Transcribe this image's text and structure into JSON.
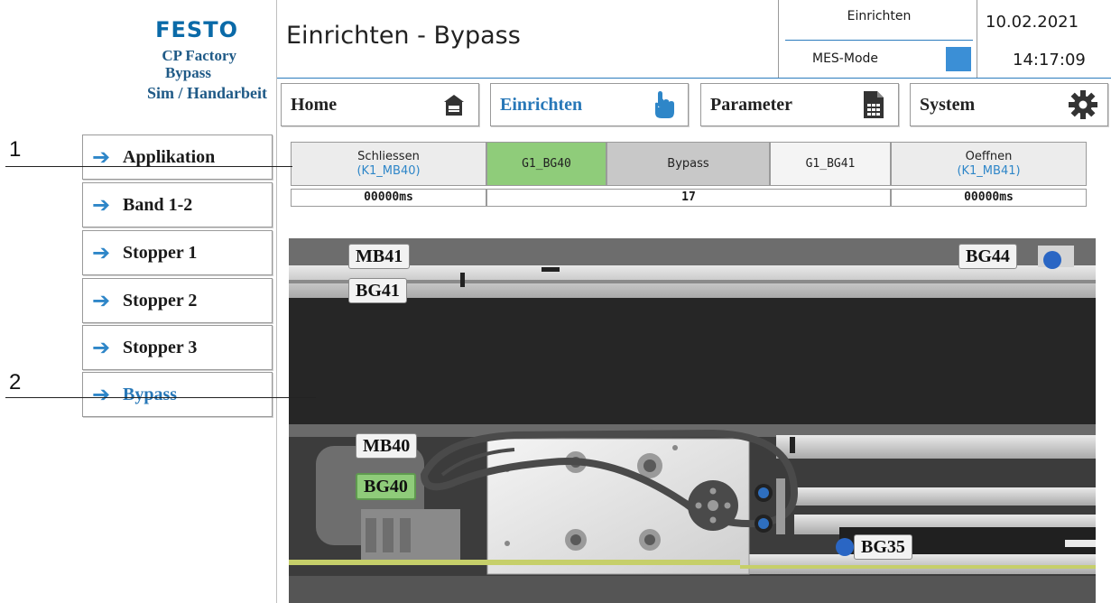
{
  "brand": {
    "logo": "FESTO",
    "line1": "CP Factory",
    "line2": "Bypass",
    "line3": "Sim / Handarbeit"
  },
  "header": {
    "title": "Einrichten - Bypass",
    "mode": "Einrichten",
    "mes_label": "MES-Mode",
    "mes_color": "#3b8fd6",
    "date": "10.02.2021",
    "time": "14:17:09"
  },
  "nav": [
    {
      "label": "Home",
      "icon": "house-icon"
    },
    {
      "label": "Einrichten",
      "icon": "hand-pointer-icon",
      "active": true
    },
    {
      "label": "Parameter",
      "icon": "document-table-icon"
    },
    {
      "label": "System",
      "icon": "gear-icon"
    }
  ],
  "sidebar": {
    "items": [
      {
        "label": "Applikation"
      },
      {
        "label": "Band 1-2"
      },
      {
        "label": "Stopper 1"
      },
      {
        "label": "Stopper 2"
      },
      {
        "label": "Stopper 3"
      },
      {
        "label": "Bypass",
        "active": true
      }
    ]
  },
  "callouts": [
    "1",
    "2"
  ],
  "status": {
    "schliessen": "Schliessen",
    "schliessen_sub": "(K1_MB40)",
    "g1_bg40": "G1_BG40",
    "bypass": "Bypass",
    "g1_bg41": "G1_BG41",
    "oeffnen": "Oeffnen",
    "oeffnen_sub": "(K1_MB41)",
    "time_left": "00000ms",
    "count": "17",
    "time_right": "00000ms"
  },
  "sensors": {
    "mb41": "MB41",
    "bg41": "BG41",
    "bg44": "BG44",
    "mb40": "MB40",
    "bg40": "BG40",
    "bg35": "BG35"
  },
  "colors": {
    "accent": "#2878b8",
    "active_green": "#8fcc7a",
    "festo_blue": "#0a6aa8"
  }
}
